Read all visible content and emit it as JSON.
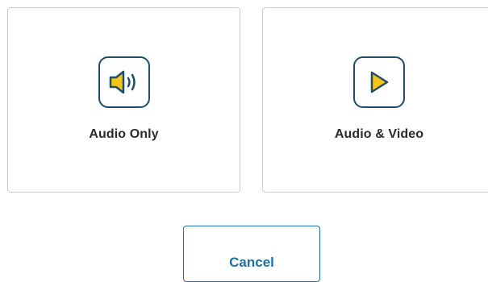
{
  "options": {
    "audio_only": {
      "label": "Audio Only",
      "icon": "speaker-icon"
    },
    "audio_video": {
      "label": "Audio & Video",
      "icon": "play-icon"
    }
  },
  "actions": {
    "cancel_label": "Cancel"
  },
  "colors": {
    "icon_outline": "#1f4d6b",
    "icon_fill": "#f5c518",
    "accent": "#1f6fa3",
    "card_border": "#c9cdd1",
    "label_text": "#2b2b2b"
  }
}
